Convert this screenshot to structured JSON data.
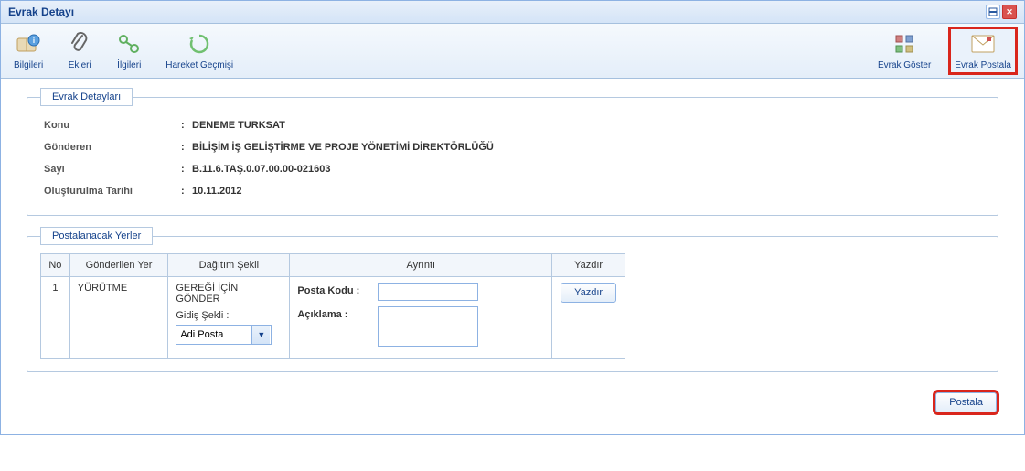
{
  "window": {
    "title": "Evrak Detayı"
  },
  "toolbar": {
    "left": {
      "bilgileri": "Bilgileri",
      "ekleri": "Ekleri",
      "ilgileri": "İlgileri",
      "hareket": "Hareket Geçmişi"
    },
    "right": {
      "goster": "Evrak Göster",
      "postala": "Evrak Postala"
    }
  },
  "details": {
    "legend": "Evrak Detayları",
    "konu": {
      "label": "Konu",
      "value": "DENEME TURKSAT"
    },
    "gonderen": {
      "label": "Gönderen",
      "value": "BİLİŞİM İŞ GELİŞTİRME VE PROJE YÖNETİMİ DİREKTÖRLÜĞÜ"
    },
    "sayi": {
      "label": "Sayı",
      "value": "B.11.6.TAŞ.0.07.00.00-021603"
    },
    "tarih": {
      "label": "Oluşturulma Tarihi",
      "value": "10.11.2012"
    }
  },
  "postalanacak": {
    "legend": "Postalanacak Yerler",
    "headers": {
      "no": "No",
      "yer": "Gönderilen Yer",
      "dagitim": "Dağıtım Şekli",
      "ayrinti": "Ayrıntı",
      "yazdir": "Yazdır"
    },
    "row": {
      "no": "1",
      "yer": "YÜRÜTME",
      "geregi": "GEREĞİ İÇİN GÖNDER",
      "gidis_label": "Gidiş Şekli :",
      "gidis_value": "Adi Posta",
      "posta_kodu_label": "Posta Kodu :",
      "posta_kodu_value": "",
      "aciklama_label": "Açıklama :",
      "aciklama_value": "",
      "yazdir_btn": "Yazdır"
    }
  },
  "footer": {
    "postala": "Postala"
  },
  "icons": {
    "bilgileri": "book-info-icon",
    "ekleri": "paperclip-icon",
    "ilgileri": "link-icon",
    "hareket": "refresh-icon",
    "goster": "grid-icon",
    "postala": "envelope-icon"
  }
}
